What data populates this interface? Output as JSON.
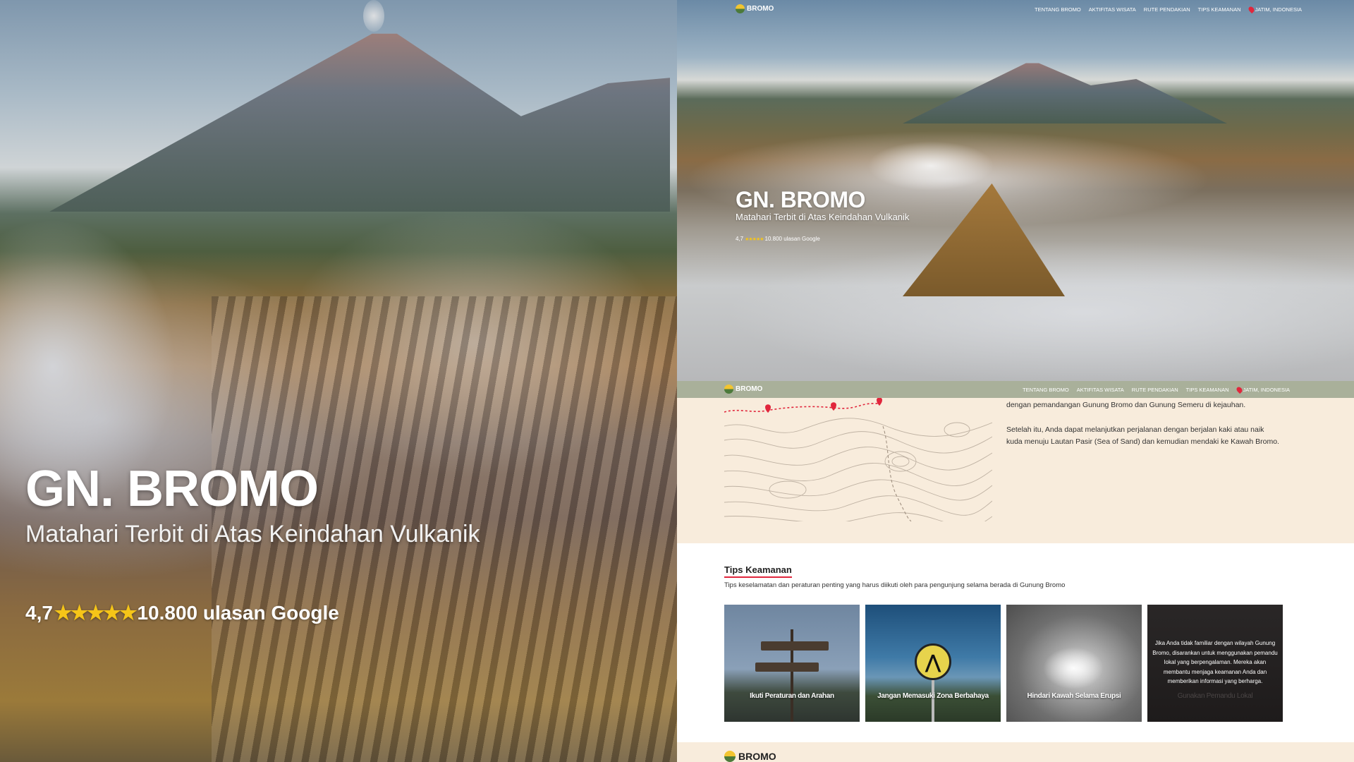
{
  "zoom_view": {
    "hero": {
      "title": "GN. BROMO",
      "subtitle": "Matahari Terbit di Atas Keindahan Vulkanik",
      "rating_value": "4,7",
      "stars": "★★★★★",
      "rating_count": "10.800 ulasan Google"
    }
  },
  "page": {
    "brand": "BROMO",
    "nav": {
      "items": [
        "TENTANG BROMO",
        "AKTIFITAS WISATA",
        "RUTE PENDAKIAN",
        "TIPS KEAMANAN"
      ],
      "location": "JATIM, INDONESIA"
    },
    "hero": {
      "title": "GN. BROMO",
      "subtitle": "Matahari Terbit di Atas Keindahan Vulkanik",
      "rating_value": "4,7",
      "stars": "★★★★★",
      "rating_count": "10.800 ulasan Google"
    },
    "route": {
      "paragraphs": [
        "dengan pemandangan Gunung Bromo dan Gunung Semeru di kejauhan.",
        "Setelah itu, Anda dapat melanjutkan perjalanan dengan berjalan kaki atau naik kuda menuju Lautan Pasir (Sea of Sand) dan kemudian mendaki ke Kawah Bromo."
      ]
    },
    "tips": {
      "title": "Tips Keamanan",
      "description": "Tips keselamatan dan peraturan penting yang harus diikuti oleh para pengunjung selama berada di Gunung Bromo",
      "card1_label": "Ikuti Peraturan dan Arahan",
      "card2_label": "Jangan Memasuki Zona Berbahaya",
      "card3_label": "Hindari Kawah Selama Erupsi",
      "card4_label": "Gunakan Pemandu Lokal",
      "card4_overlay": "Jika Anda tidak familiar dengan wilayah Gunung Bromo, disarankan untuk menggunakan pemandu lokal yang berpengalaman. Mereka akan membantu menjaga keamanan Anda dan memberikan informasi yang berharga."
    },
    "footer": {
      "brand": "BROMO"
    }
  },
  "colors": {
    "accent": "#e1263c",
    "star": "#f5c518",
    "sticky_nav": "#a9b09a",
    "cream": "#f8ecdc"
  }
}
